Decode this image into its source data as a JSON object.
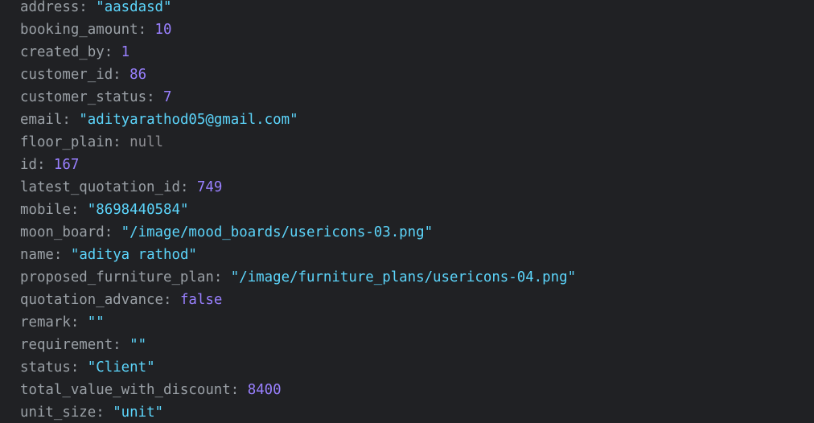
{
  "colors": {
    "background": "#202124",
    "key": "#9aa0a6",
    "string": "#5cd5fb",
    "number": "#9980ff",
    "boolean": "#9980ff",
    "null": "#8e8e93"
  },
  "properties": [
    {
      "key": "address",
      "value": "\"aasdasd\"",
      "type": "string"
    },
    {
      "key": "booking_amount",
      "value": "10",
      "type": "number"
    },
    {
      "key": "created_by",
      "value": "1",
      "type": "number"
    },
    {
      "key": "customer_id",
      "value": "86",
      "type": "number"
    },
    {
      "key": "customer_status",
      "value": "7",
      "type": "number"
    },
    {
      "key": "email",
      "value": "\"adityarathod05@gmail.com\"",
      "type": "string"
    },
    {
      "key": "floor_plain",
      "value": "null",
      "type": "null"
    },
    {
      "key": "id",
      "value": "167",
      "type": "number"
    },
    {
      "key": "latest_quotation_id",
      "value": "749",
      "type": "number"
    },
    {
      "key": "mobile",
      "value": "\"8698440584\"",
      "type": "string"
    },
    {
      "key": "moon_board",
      "value": "\"/image/mood_boards/usericons-03.png\"",
      "type": "string"
    },
    {
      "key": "name",
      "value": "\"aditya rathod\"",
      "type": "string"
    },
    {
      "key": "proposed_furniture_plan",
      "value": "\"/image/furniture_plans/usericons-04.png\"",
      "type": "string"
    },
    {
      "key": "quotation_advance",
      "value": "false",
      "type": "boolean"
    },
    {
      "key": "remark",
      "value": "\"\"",
      "type": "string"
    },
    {
      "key": "requirement",
      "value": "\"\"",
      "type": "string"
    },
    {
      "key": "status",
      "value": "\"Client\"",
      "type": "string"
    },
    {
      "key": "total_value_with_discount",
      "value": "8400",
      "type": "number"
    },
    {
      "key": "unit_size",
      "value": "\"unit\"",
      "type": "string"
    }
  ]
}
